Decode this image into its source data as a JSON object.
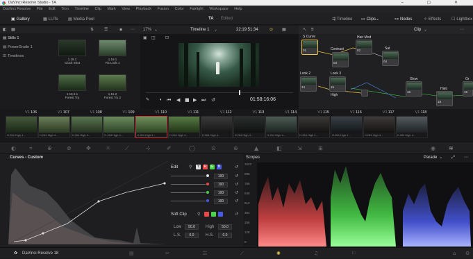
{
  "app": {
    "title": "DaVinci Resolve Studio - TA",
    "window_controls": "–  ▢  ✕"
  },
  "menu": [
    "DaVinci Resolve",
    "File",
    "Edit",
    "Trim",
    "Timeline",
    "Clip",
    "Mark",
    "View",
    "Playback",
    "Fusion",
    "Color",
    "Fairlight",
    "Workspace",
    "Help"
  ],
  "toolbar": {
    "gallery": "Gallery",
    "luts": "LUTs",
    "media_pool": "Media Pool",
    "project": "TA",
    "status": "Edited",
    "timeline": "Timeline",
    "clips": "Clips",
    "nodes": "Nodes",
    "effects": "Effects",
    "lightbox": "Lightbox"
  },
  "gallery": {
    "albums": [
      "Stills 1",
      "PowerGrade 1",
      "Timelines"
    ],
    "stills": [
      {
        "id": "1.18.1",
        "name": "Clock Shot"
      },
      {
        "id": "1.18.1",
        "name": "Fix Look 1"
      },
      {
        "id": "1.16.2.1",
        "name": "Forest Try"
      },
      {
        "id": "1.16.2",
        "name": "Forest Try 2"
      }
    ]
  },
  "viewer": {
    "zoom": "17%",
    "timeline_name": "Timeline 1",
    "timecode_top": "22:19:51:34",
    "timecode": "01:58:16:06"
  },
  "nodes": {
    "mode": "Clip",
    "labels": [
      "S Curve",
      "Hair Mod",
      "Contrast",
      "Sat",
      "Look 2",
      "Look 3",
      "High",
      "Glow",
      "Halo",
      "Gr"
    ],
    "node_ids": [
      "01",
      "02",
      "03",
      "04",
      "14",
      "15",
      "16",
      "18",
      "19"
    ]
  },
  "clips": {
    "numbers": [
      "106",
      "107",
      "108",
      "109",
      "110",
      "111",
      "112",
      "113",
      "114",
      "115",
      "116",
      "117",
      "118"
    ],
    "tracks": [
      "V1",
      "V1",
      "V1",
      "V1",
      "V1",
      "V1",
      "V1",
      "V1",
      "V1",
      "V1",
      "V1",
      "V1",
      "V1"
    ],
    "codec": "H.264 High 4..."
  },
  "curves": {
    "title": "Curves - Custom",
    "edit_label": "Edit",
    "channels": [
      "Y",
      "R",
      "G",
      "B"
    ],
    "values": [
      "100",
      "100",
      "100",
      "100"
    ],
    "soft_clip_label": "Soft Clip",
    "low_label": "Low",
    "low_value": "50.0",
    "high_label": "High",
    "high_value": "50.0",
    "ls_label": "L.S.",
    "ls_value": "0.0",
    "hs_label": "H.S.",
    "hs_value": "0.0"
  },
  "scopes": {
    "title": "Scopes",
    "mode": "Parade",
    "scale": [
      "1023",
      "896",
      "768",
      "640",
      "512",
      "384",
      "256",
      "128",
      "0"
    ]
  },
  "footer": {
    "app_name": "DaVinci Resolve 18"
  },
  "colors": {
    "accent": "#e9c34a",
    "red": "#e84a4a",
    "green": "#4ad64a",
    "blue": "#4a5ae8",
    "selected_clip": "#d03a3a"
  }
}
